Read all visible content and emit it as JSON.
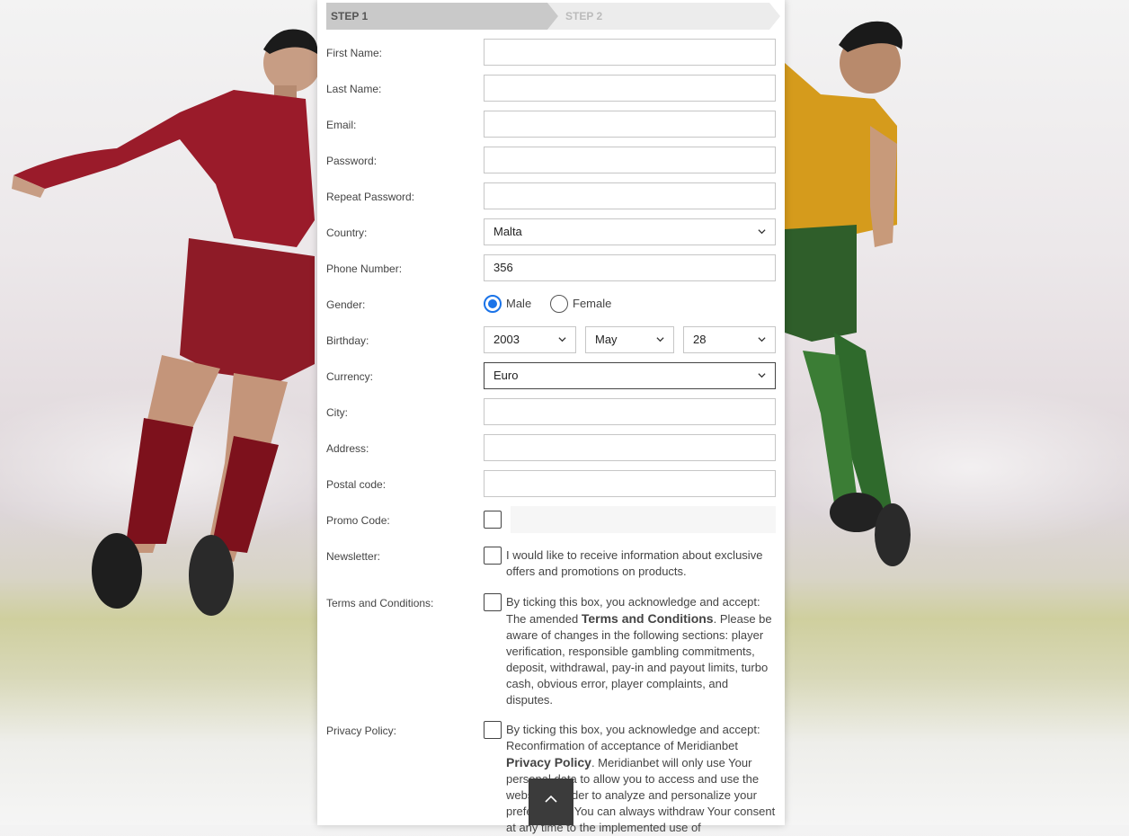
{
  "steps": {
    "step1": "STEP 1",
    "step2": "STEP 2"
  },
  "labels": {
    "first_name": "First Name:",
    "last_name": "Last Name:",
    "email": "Email:",
    "password": "Password:",
    "repeat_password": "Repeat Password:",
    "country": "Country:",
    "phone": "Phone Number:",
    "gender": "Gender:",
    "birthday": "Birthday:",
    "currency": "Currency:",
    "city": "City:",
    "address": "Address:",
    "postal_code": "Postal code:",
    "promo_code": "Promo Code:",
    "newsletter": "Newsletter:",
    "terms": "Terms and Conditions:",
    "privacy": "Privacy Policy:"
  },
  "values": {
    "country": "Malta",
    "phone": "356",
    "birth_year": "2003",
    "birth_month": "May",
    "birth_day": "28",
    "currency": "Euro"
  },
  "gender": {
    "male": "Male",
    "female": "Female",
    "selected": "Male"
  },
  "newsletter_text": "I would like to receive information about exclusive offers and promotions on products.",
  "terms": {
    "pre": "By ticking this box, you acknowledge and accept: The amended ",
    "link": "Terms and Conditions",
    "post": ". Please be aware of changes in the following sections: player verification, responsible gambling commitments, deposit, withdrawal, pay-in and payout limits, turbo cash, obvious error, player complaints, and disputes."
  },
  "privacy": {
    "pre": "By ticking this box, you acknowledge and accept: Reconfirmation of acceptance of Meridianbet ",
    "link": "Privacy Policy",
    "post": ". Meridianbet will only use Your personal data to allow you to access and use the website in order to analyze and personalize your preferences. You can always withdraw Your consent at any time to the implemented use of"
  },
  "icons": {
    "select": "chevron-down-icon",
    "scroll_top": "chevron-up-icon"
  },
  "colors": {
    "accent": "#1a73e8",
    "step_active": "#c9c9c9",
    "step_inactive": "#ececec"
  }
}
